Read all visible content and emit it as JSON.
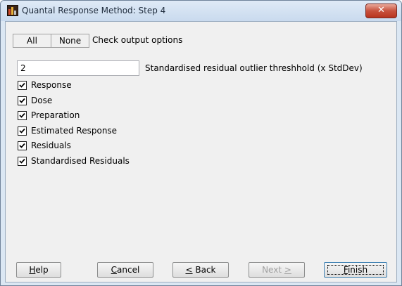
{
  "window": {
    "title": "Quantal Response Method: Step 4",
    "close_label": "✕"
  },
  "toolbar": {
    "all_label": "All",
    "none_label": "None",
    "check_label": "Check output options"
  },
  "threshold": {
    "value": "2",
    "label": "Standardised residual outlier threshhold (x StdDev)"
  },
  "options": [
    {
      "label": "Response",
      "checked": true
    },
    {
      "label": "Dose",
      "checked": true
    },
    {
      "label": "Preparation",
      "checked": true
    },
    {
      "label": "Estimated Response",
      "checked": true
    },
    {
      "label": "Residuals",
      "checked": true
    },
    {
      "label": "Standardised Residuals",
      "checked": true
    }
  ],
  "footer": {
    "help": {
      "pre": "",
      "key": "H",
      "post": "elp"
    },
    "cancel": {
      "pre": "",
      "key": "C",
      "post": "ancel"
    },
    "back": {
      "pre": "",
      "key": "<",
      "post": " Back"
    },
    "next": {
      "pre": "Next ",
      "key": ">",
      "post": ""
    },
    "finish": {
      "pre": "",
      "key": "F",
      "post": "inish"
    }
  },
  "colors": {
    "window_border": "#6f8299",
    "titlebar": "#c9daee",
    "client": "#f0f0f0",
    "close_button": "#c8513d"
  }
}
